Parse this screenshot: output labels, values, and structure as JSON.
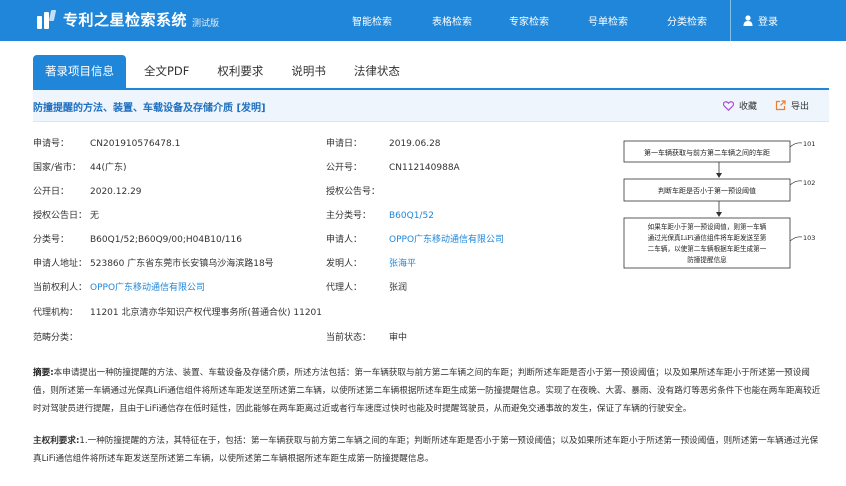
{
  "header": {
    "app_title": "专利之星检索系统",
    "version_tag": "测试版",
    "nav": [
      "智能检索",
      "表格检索",
      "专家检索",
      "号单检索",
      "分类检索"
    ],
    "login_label": "登录"
  },
  "tabs": [
    "著录项目信息",
    "全文PDF",
    "权利要求",
    "说明书",
    "法律状态"
  ],
  "active_tab": "著录项目信息",
  "patent_title": "防撞提醒的方法、装置、车载设备及存储介质 [发明]",
  "actions": {
    "favorite": "收藏",
    "export": "导出"
  },
  "fields": {
    "app_no": {
      "label": "申请号：",
      "value": "CN201910576478.1"
    },
    "app_date": {
      "label": "申请日：",
      "value": "2019.06.28"
    },
    "country": {
      "label": "国家/省市：",
      "value": "44(广东)"
    },
    "pub_no": {
      "label": "公开号：",
      "value": "CN112140988A"
    },
    "pub_date": {
      "label": "公开日：",
      "value": "2020.12.29"
    },
    "grant_no": {
      "label": "授权公告号：",
      "value": ""
    },
    "grant_date": {
      "label": "授权公告日：",
      "value": "无"
    },
    "main_class": {
      "label": "主分类号：",
      "value": "B60Q1/52"
    },
    "classes": {
      "label": "分类号：",
      "value": "B60Q1/52;B60Q9/00;H04B10/116"
    },
    "applicant": {
      "label": "申请人：",
      "value": "OPPO广东移动通信有限公司"
    },
    "address": {
      "label": "申请人地址：",
      "value": "523860 广东省东莞市长安镇乌沙海滨路18号"
    },
    "inventor": {
      "label": "发明人：",
      "value": "张海平"
    },
    "holder": {
      "label": "当前权利人：",
      "value": "OPPO广东移动通信有限公司"
    },
    "agent": {
      "label": "代理人：",
      "value": "张润"
    },
    "agency": {
      "label": "代理机构：",
      "value": "11201 北京清亦华知识产权代理事务所(普通合伙) 11201"
    },
    "scope": {
      "label": "范畴分类：",
      "value": ""
    },
    "status": {
      "label": "当前状态：",
      "value": "审中"
    }
  },
  "diagram": {
    "steps": [
      {
        "id": "101",
        "lines": [
          "第一车辆获取与前方第二车辆之间的车距"
        ]
      },
      {
        "id": "102",
        "lines": [
          "判断车距是否小于第一预设阈值"
        ]
      },
      {
        "id": "103",
        "lines": [
          "如果车距小于第一预设阈值，则第一车辆",
          "通过光保真LiFi通信组件将车距发送至第",
          "二车辆，以使第二车辆根据车距生成第一",
          "防撞提醒信息"
        ]
      }
    ]
  },
  "abstract": {
    "label": "摘要:",
    "text": "本申请提出一种防撞提醒的方法、装置、车载设备及存储介质，所述方法包括：第一车辆获取与前方第二车辆之间的车距；判断所述车距是否小于第一预设阈值；以及如果所述车距小于所述第一预设阈值，则所述第一车辆通过光保真LiFi通信组件将所述车距发送至所述第二车辆，以使所述第二车辆根据所述车距生成第一防撞提醒信息。实现了在夜晚、大雾、暴雨、没有路灯等恶劣条件下也能在两车距离较近时对驾驶员进行提醒，且由于LiFi通信存在低时延性，因此能够在两车距离过近或者行车速度过快时也能及时提醒驾驶员，从而避免交通事故的发生，保证了车辆的行驶安全。"
  },
  "claim": {
    "label": "主权利要求:",
    "text": "1.一种防撞提醒的方法，其特征在于，包括：第一车辆获取与前方第二车辆之间的车距；判断所述车距是否小于第一预设阈值；以及如果所述车距小于所述第一预设阈值，则所述第一车辆通过光保真LiFi通信组件将所述车距发送至所述第二车辆，以使所述第二车辆根据所述车距生成第一防撞提醒信息。"
  }
}
